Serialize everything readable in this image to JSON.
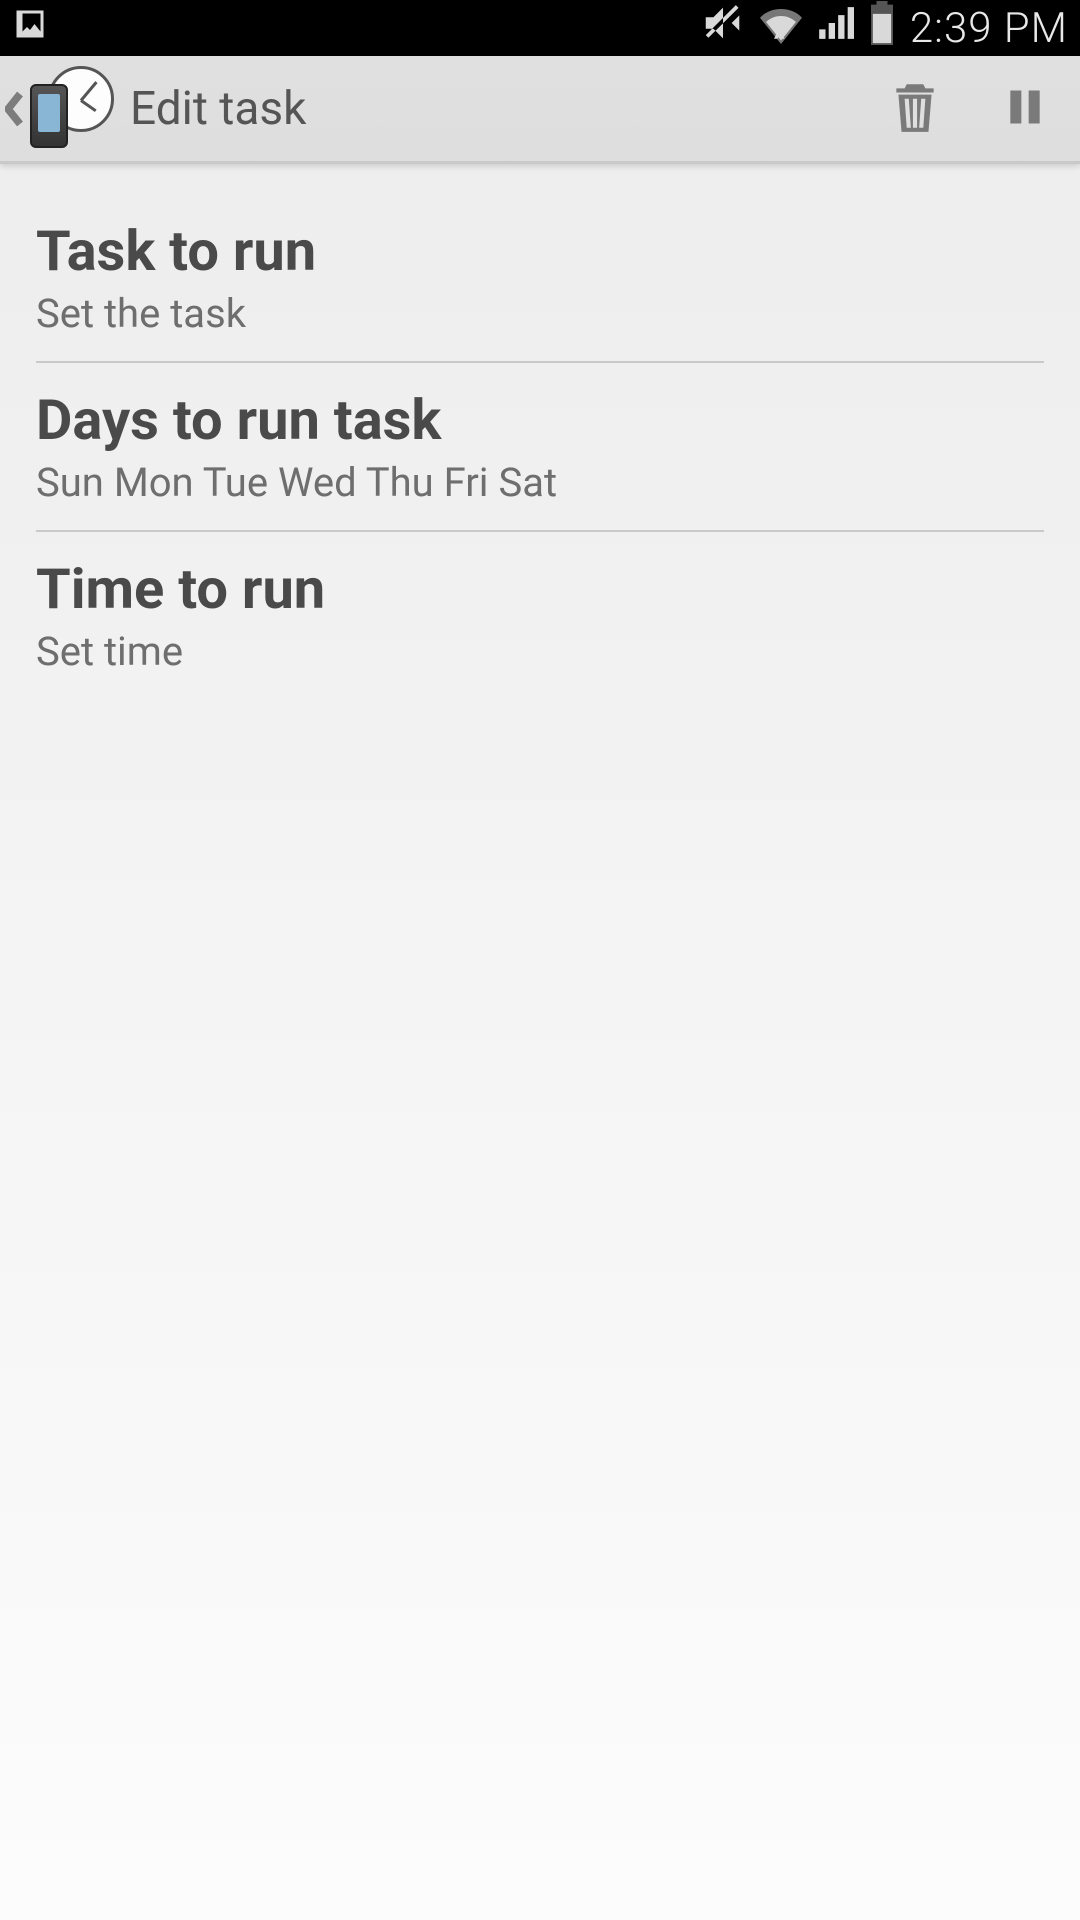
{
  "status_bar": {
    "time": "2:39 PM"
  },
  "action_bar": {
    "title": "Edit task",
    "icons": {
      "back": "back-icon",
      "app": "app-phone-clock-icon",
      "delete": "trash-icon",
      "pause": "pause-icon"
    }
  },
  "list": [
    {
      "title": "Task to run",
      "subtitle": "Set the task"
    },
    {
      "title": "Days to run task",
      "subtitle": "Sun Mon Tue Wed Thu Fri Sat"
    },
    {
      "title": "Time to run",
      "subtitle": "Set time"
    }
  ]
}
